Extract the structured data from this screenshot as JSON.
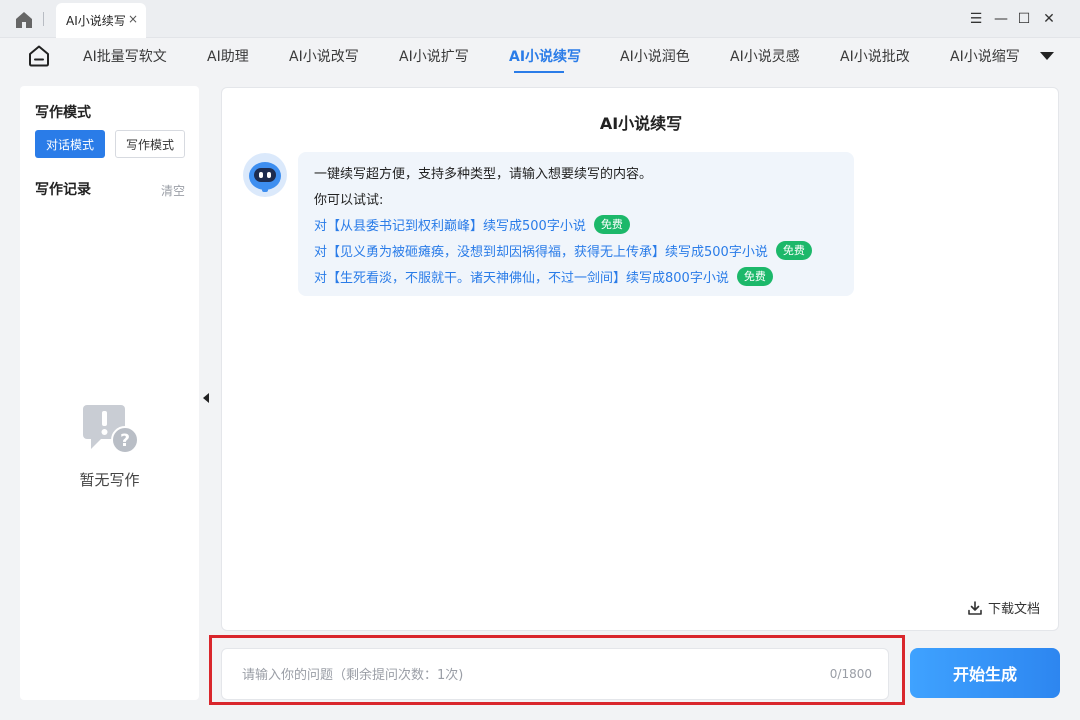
{
  "titlebar": {
    "tab_title": "AI小说续写",
    "tab_close": "×",
    "controls": {
      "menu": "☰",
      "minimize": "—",
      "maximize": "☐",
      "close": "✕"
    }
  },
  "nav": {
    "items": [
      {
        "label": "AI批量写软文",
        "active": false
      },
      {
        "label": "AI助理",
        "active": false
      },
      {
        "label": "AI小说改写",
        "active": false
      },
      {
        "label": "AI小说扩写",
        "active": false
      },
      {
        "label": "AI小说续写",
        "active": true
      },
      {
        "label": "AI小说润色",
        "active": false
      },
      {
        "label": "AI小说灵感",
        "active": false
      },
      {
        "label": "AI小说批改",
        "active": false
      },
      {
        "label": "AI小说缩写",
        "active": false
      }
    ]
  },
  "sidebar": {
    "mode_heading": "写作模式",
    "mode_chat": "对话模式",
    "mode_write": "写作模式",
    "records_heading": "写作记录",
    "clear": "清空",
    "empty_text": "暂无写作"
  },
  "chat": {
    "title": "AI小说续写",
    "intro": "一键续写超方便，支持多种类型，请输入想要续写的内容。",
    "try_label": "你可以试试:",
    "suggestions": [
      {
        "text": "对【从县委书记到权利巅峰】续写成500字小说",
        "badge": "免费"
      },
      {
        "text": "对【见义勇为被砸瘫痪，没想到却因祸得福，获得无上传承】续写成500字小说",
        "badge": "免费"
      },
      {
        "text": "对【生死看淡，不服就干。诸天神佛仙，不过一剑间】续写成800字小说",
        "badge": "免费"
      }
    ],
    "download": "下载文档"
  },
  "input": {
    "placeholder": "请输入你的问题（剩余提问次数：1次)",
    "counter": "0/1800",
    "submit": "开始生成"
  },
  "colors": {
    "accent": "#2a7ce8",
    "badge_green": "#1cb86a",
    "highlight_red": "#d9262c"
  }
}
